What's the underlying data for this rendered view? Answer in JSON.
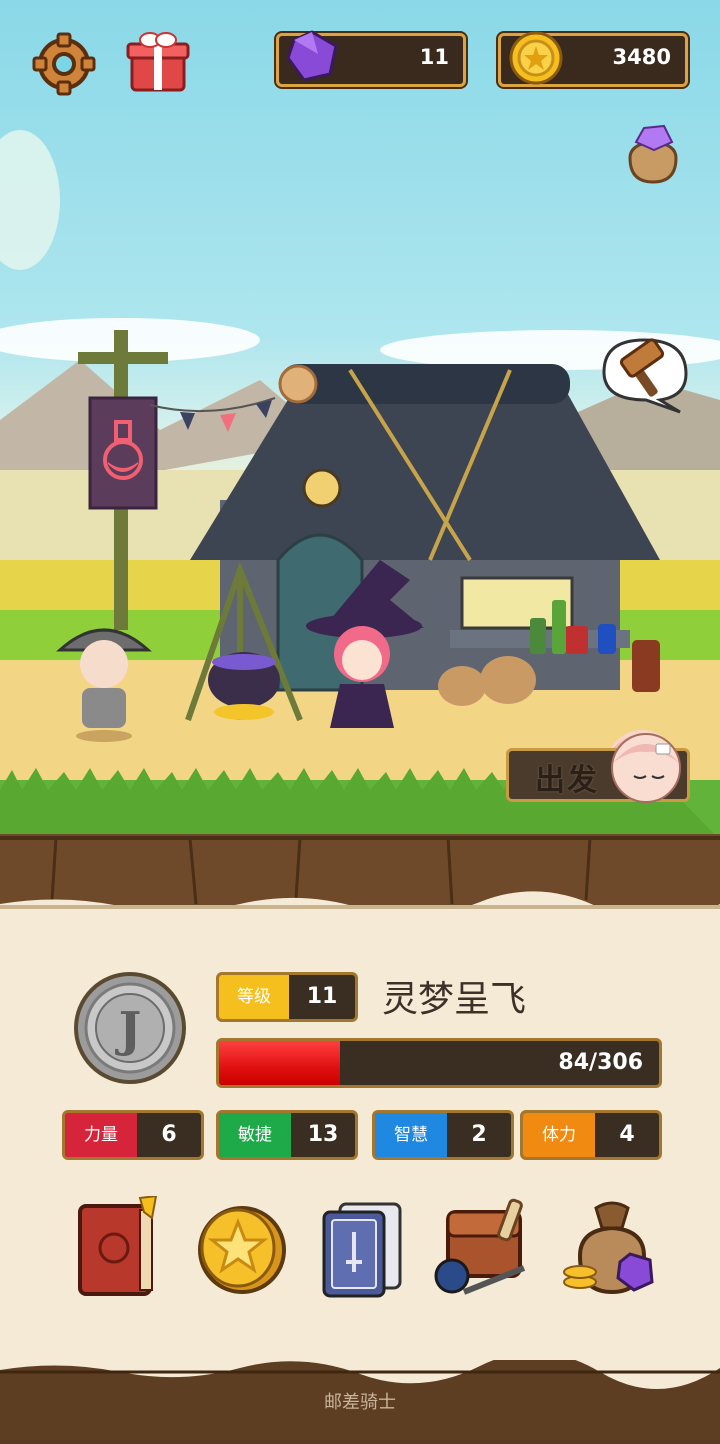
{
  "top_bar": {
    "gems": "11",
    "coins": "3480",
    "icons": [
      "gear-icon",
      "gift-icon",
      "gem-icon",
      "coin-icon",
      "gem-bag-icon"
    ]
  },
  "scene": {
    "go_button_label": "出发",
    "shop_sign_icon": "potion-flask-icon",
    "speech_bubble_icon": "hammer-icon"
  },
  "character": {
    "emblem_letter": "J",
    "level_label": "等级",
    "level": "11",
    "name": "灵梦呈飞",
    "hp_text": "84/306",
    "hp_current": 84,
    "hp_max": 306
  },
  "stats": [
    {
      "label": "力量",
      "value": "6",
      "color": "#d6253a"
    },
    {
      "label": "敏捷",
      "value": "13",
      "color": "#1faa4a"
    },
    {
      "label": "智慧",
      "value": "2",
      "color": "#1f88e0"
    },
    {
      "label": "体力",
      "value": "4",
      "color": "#f08a10"
    }
  ],
  "menu": {
    "icons": [
      "journal-book-icon",
      "star-coin-icon",
      "card-deck-icon",
      "equipment-bag-icon",
      "treasure-bag-icon"
    ]
  },
  "footer": {
    "title": "邮差骑士"
  }
}
